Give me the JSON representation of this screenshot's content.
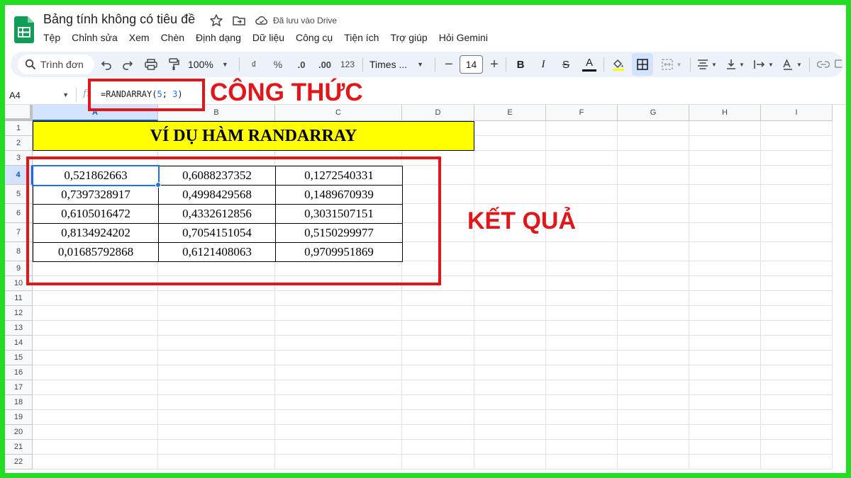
{
  "app": {
    "document_title": "Bảng tính không có tiêu đề",
    "save_status": "Đã lưu vào Drive"
  },
  "menu": [
    "Tệp",
    "Chỉnh sửa",
    "Xem",
    "Chèn",
    "Định dạng",
    "Dữ liệu",
    "Công cụ",
    "Tiện ích",
    "Trợ giúp",
    "Hỏi Gemini"
  ],
  "toolbar": {
    "search_label": "Trình đơn",
    "zoom": "100%",
    "currency": "₫",
    "percent": "%",
    "decrease_decimal": ".0",
    "increase_decimal": ".00",
    "number_format": "123",
    "font": "Times ...",
    "font_size": "14",
    "bold": "B",
    "italic": "I",
    "strikethrough": "S",
    "text_color": "A"
  },
  "formula_bar": {
    "cell_ref": "A4",
    "fx": "fx",
    "formula": "=RANDARRAY(5; 3)"
  },
  "grid": {
    "columns": [
      "A",
      "B",
      "C",
      "D",
      "E",
      "F",
      "G",
      "H",
      "I"
    ],
    "rows": [
      "1",
      "2",
      "3",
      "4",
      "5",
      "6",
      "7",
      "8",
      "9",
      "10",
      "11",
      "12",
      "13",
      "14",
      "15",
      "16",
      "17",
      "18",
      "19",
      "20",
      "21",
      "22"
    ],
    "selected_cell": "A4",
    "title": "VÍ DỤ HÀM RANDARRAY",
    "values": [
      [
        "0,521862663",
        "0,6088237352",
        "0,1272540331"
      ],
      [
        "0,7397328917",
        "0,4998429568",
        "0,1489670939"
      ],
      [
        "0,6105016472",
        "0,4332612856",
        "0,3031507151"
      ],
      [
        "0,8134924202",
        "0,7054151054",
        "0,5150299977"
      ],
      [
        "0,01685792868",
        "0,6121408063",
        "0,9709951869"
      ]
    ]
  },
  "annotations": {
    "formula_label": "CÔNG THỨC",
    "result_label": "KẾT QUẢ",
    "color": "#e0161b"
  },
  "colors": {
    "frame": "#22dd22",
    "title_fill": "#ffff00",
    "selection": "#1a73e8"
  }
}
